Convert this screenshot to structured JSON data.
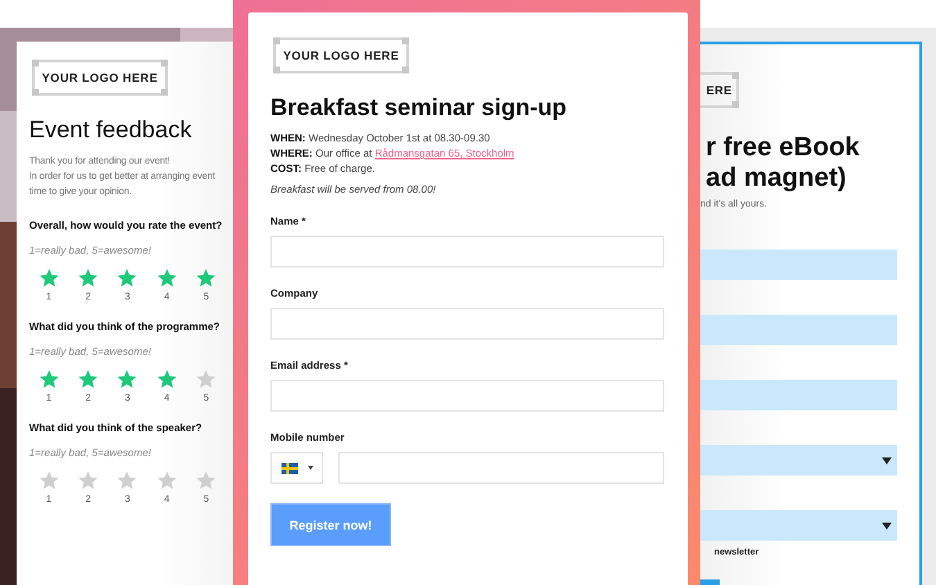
{
  "feedback_form": {
    "logo": "YOUR LOGO HERE",
    "title": "Event feedback",
    "intro": [
      "Thank you for attending our event!",
      "In order for us to get better at arranging event",
      "time to give your opinion."
    ],
    "questions": [
      {
        "question": "Overall, how would you rate the event?",
        "hint": "1=really bad, 5=awesome!",
        "stars": 5,
        "labels": [
          "1",
          "2",
          "3",
          "4",
          "5"
        ]
      },
      {
        "question": "What did you think of the programme?",
        "hint": "1=really bad, 5=awesome!",
        "stars": 4,
        "labels": [
          "1",
          "2",
          "3",
          "4",
          "5"
        ]
      },
      {
        "question": "What did you think of the speaker?",
        "hint": "1=really bad, 5=awesome!",
        "stars": 0,
        "labels": [
          "1",
          "2",
          "3",
          "4",
          "5"
        ]
      }
    ]
  },
  "signup_form": {
    "logo": "YOUR LOGO HERE",
    "title": "Breakfast seminar sign-up",
    "info": [
      {
        "label": "WHEN:",
        "text": "Wednesday October 1st at 08.30-09.30"
      },
      {
        "label": "WHERE:",
        "text": "Our office at",
        "link": "Rådmansgatan 65, Stockholm"
      },
      {
        "label": "COST:",
        "text": "Free of charge."
      }
    ],
    "note": "Breakfast will be served from 08.00!",
    "fields": [
      {
        "kind": "text",
        "label": "Name *"
      },
      {
        "kind": "text",
        "label": "Company"
      },
      {
        "kind": "text",
        "label": "Email address *"
      },
      {
        "kind": "phone",
        "label": "Mobile number"
      }
    ],
    "button": "Register now!"
  },
  "ebook_form": {
    "logo": "ERE",
    "title": [
      "r free eBook",
      "ad magnet)"
    ],
    "subtitle": "nd it's all yours.",
    "fields": [
      {
        "kind": "text"
      },
      {
        "kind": "text"
      },
      {
        "kind": "text"
      },
      {
        "kind": "select"
      },
      {
        "kind": "select"
      }
    ],
    "checkbox_label": "newsletter"
  }
}
